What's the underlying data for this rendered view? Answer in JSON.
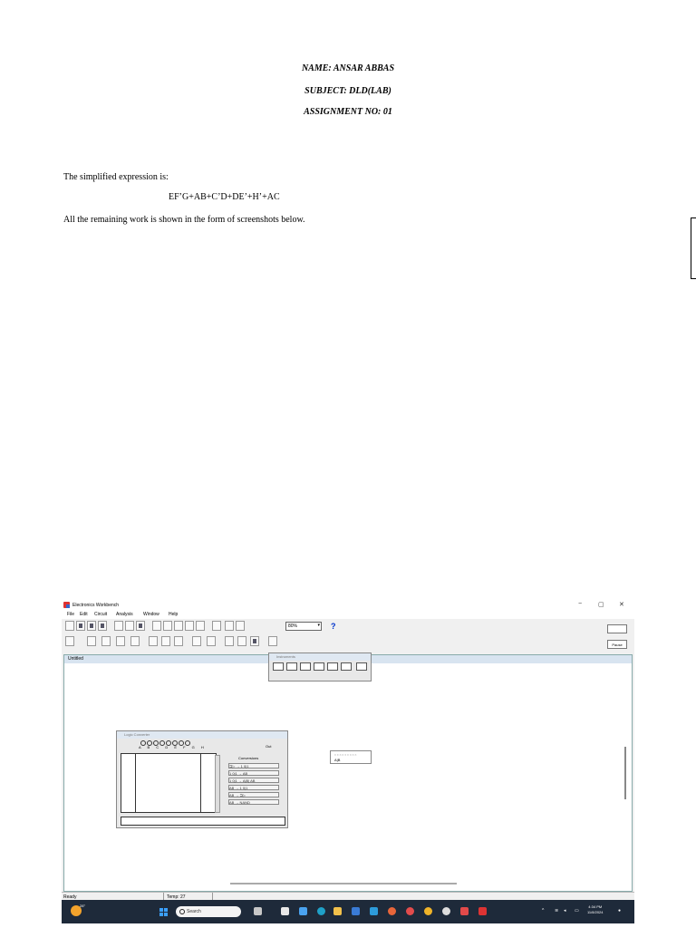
{
  "document": {
    "name_line": "NAME: ANSAR ABBAS",
    "subject_line": "SUBJECT: DLD(LAB)",
    "assignment_line": "ASSIGNMENT NO: 01",
    "intro": "The simplified expression is:",
    "expression": "EF’G+AB+C’D+DE’+H’+AC",
    "closing": "All the remaining work is shown in the form of screenshots below."
  },
  "screenshot": {
    "app_title": "Electronics Workbench",
    "window_controls": [
      "−",
      "▢",
      "✕"
    ],
    "menu": [
      "File",
      "Edit",
      "Circuit",
      "Analysis",
      "Window",
      "Help"
    ],
    "zoom_value": "80%",
    "help_label": "?",
    "pause_label": "Pause",
    "document_title": "Untitled",
    "instruments_title": "Instruments",
    "logic_converter": {
      "title": "Logic Converter",
      "out_label": "Out",
      "input_letters": "A B C D E F G H",
      "conversions_label": "Conversions",
      "conversions": [
        "⊐▷  →  1 0|1",
        "1 0|1  →  AB",
        "1 0|1  → A|B|  AB",
        "AB  →  1 0|1",
        "AB  →  ⊐▷",
        "AB  →  NAND"
      ]
    },
    "widget_label": "A|B",
    "status_ready": "Ready",
    "status_temp": "Temp: 27",
    "taskbar": {
      "weather_temp": "28°",
      "search_placeholder": "Search",
      "time": "4:34 PM",
      "date": "11/8/2024"
    }
  }
}
